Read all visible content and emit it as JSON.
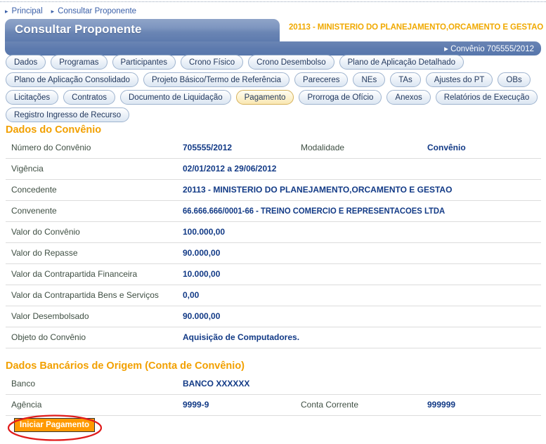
{
  "breadcrumb": {
    "arrow": "▸",
    "items": [
      {
        "label": "Principal"
      },
      {
        "label": "Consultar Proponente"
      }
    ]
  },
  "header": {
    "title": "Consultar Proponente",
    "organization": "20113 - MINISTERIO DO PLANEJAMENTO,ORCAMENTO E GESTAO",
    "context_arrow": "▸",
    "context_label": "Convênio 705555/2012"
  },
  "tabs": {
    "rows": [
      [
        {
          "label": "Dados",
          "active": false
        },
        {
          "label": "Programas",
          "active": false
        },
        {
          "label": "Participantes",
          "active": false
        },
        {
          "label": "Crono Físico",
          "active": false
        },
        {
          "label": "Crono Desembolso",
          "active": false
        },
        {
          "label": "Plano de Aplicação Detalhado",
          "active": false
        }
      ],
      [
        {
          "label": "Plano de Aplicação Consolidado",
          "active": false
        },
        {
          "label": "Projeto Básico/Termo de Referência",
          "active": false
        },
        {
          "label": "Pareceres",
          "active": false
        },
        {
          "label": "NEs",
          "active": false
        },
        {
          "label": "TAs",
          "active": false
        },
        {
          "label": "Ajustes do PT",
          "active": false
        },
        {
          "label": "OBs",
          "active": false
        }
      ],
      [
        {
          "label": "Licitações",
          "active": false
        },
        {
          "label": "Contratos",
          "active": false
        },
        {
          "label": "Documento de Liquidação",
          "active": false
        },
        {
          "label": "Pagamento",
          "active": true
        },
        {
          "label": "Prorroga de Ofício",
          "active": false
        },
        {
          "label": "Anexos",
          "active": false
        },
        {
          "label": "Relatórios de Execução",
          "active": false
        }
      ],
      [
        {
          "label": "Registro Ingresso de Recurso",
          "active": false
        }
      ]
    ]
  },
  "convenio_section": {
    "title": "Dados do Convênio",
    "rows": [
      {
        "label": "Número do Convênio",
        "value": "705555/2012",
        "label2": "Modalidade",
        "value2": "Convênio"
      },
      {
        "label": "Vigência",
        "value": "02/01/2012 a 29/06/2012"
      },
      {
        "label": "Concedente",
        "value": "20113 - MINISTERIO DO PLANEJAMENTO,ORCAMENTO E GESTAO"
      },
      {
        "label": "Convenente",
        "value": "66.666.666/0001-66 - TREINO COMERCIO E REPRESENTACOES LTDA"
      },
      {
        "label": "Valor do Convênio",
        "value": "100.000,00"
      },
      {
        "label": "Valor do Repasse",
        "value": "90.000,00"
      },
      {
        "label": "Valor da Contrapartida Financeira",
        "value": "10.000,00"
      },
      {
        "label": "Valor da Contrapartida Bens e Serviços",
        "value": "0,00"
      },
      {
        "label": "Valor Desembolsado",
        "value": "90.000,00"
      },
      {
        "label": "Objeto do Convênio",
        "value": "Aquisição de Computadores."
      }
    ]
  },
  "bank_section": {
    "title": "Dados Bancários de Origem (Conta de Convênio)",
    "rows": [
      {
        "label": "Banco",
        "value": "BANCO XXXXXX"
      },
      {
        "label": "Agência",
        "value": "9999-9",
        "label2": "Conta Corrente",
        "value2": "999999"
      }
    ]
  },
  "actions": {
    "start_payment_label": "Iniciar Pagamento",
    "annotation_color": "#e01b1b"
  },
  "colors": {
    "accent_orange": "#f2a000",
    "header_blue": "#6a85b4",
    "value_blue": "#123a86",
    "button_orange": "#ff9900"
  }
}
